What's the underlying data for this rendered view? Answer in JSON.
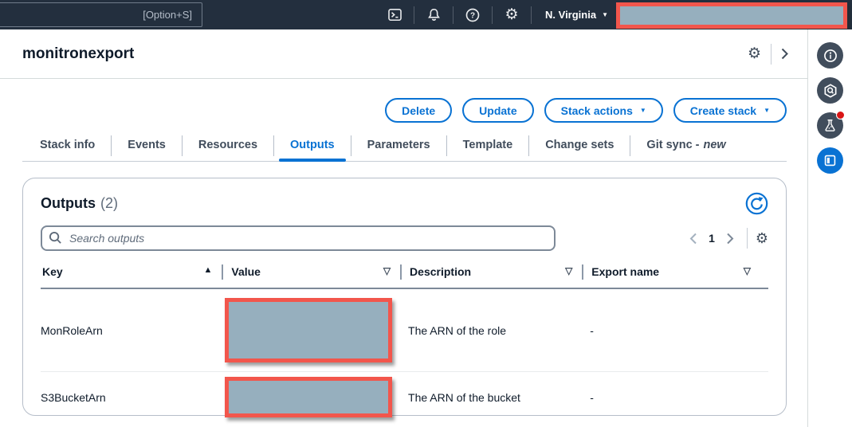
{
  "topnav": {
    "search_shortcut": "[Option+S]",
    "region": "N. Virginia"
  },
  "header": {
    "title": "monitronexport"
  },
  "actions": {
    "delete": "Delete",
    "update": "Update",
    "stack_actions": "Stack actions",
    "create_stack": "Create stack"
  },
  "tabs": [
    {
      "label": "Stack info"
    },
    {
      "label": "Events"
    },
    {
      "label": "Resources"
    },
    {
      "label": "Outputs",
      "active": true
    },
    {
      "label": "Parameters"
    },
    {
      "label": "Template"
    },
    {
      "label": "Change sets"
    },
    {
      "label": "Git sync -",
      "suffix": "new"
    }
  ],
  "outputs_panel": {
    "title": "Outputs",
    "count": "(2)",
    "search_placeholder": "Search outputs",
    "pagination": {
      "current_page": "1"
    },
    "table": {
      "columns": [
        {
          "label": "Key",
          "sort_icon": "▲"
        },
        {
          "label": "Value",
          "sort_icon": "▽"
        },
        {
          "label": "Description",
          "sort_icon": "▽"
        },
        {
          "label": "Export name",
          "sort_icon": "▽"
        }
      ],
      "rows": [
        {
          "key": "MonRoleArn",
          "value_redacted": true,
          "description": "The ARN of the role",
          "export_name": "-"
        },
        {
          "key": "S3BucketArn",
          "value_redacted": true,
          "description": "The ARN of the bucket",
          "export_name": "-"
        }
      ]
    }
  },
  "icons": {
    "caret_down": "▼",
    "gear": "⚙"
  },
  "colors": {
    "accent_blue": "#0972d3",
    "nav_bg": "#232f3e",
    "redact_fill": "#96afbe",
    "redact_border": "#f2564c",
    "dark_text": "#0f1b2a",
    "notification_red": "#d91515"
  }
}
